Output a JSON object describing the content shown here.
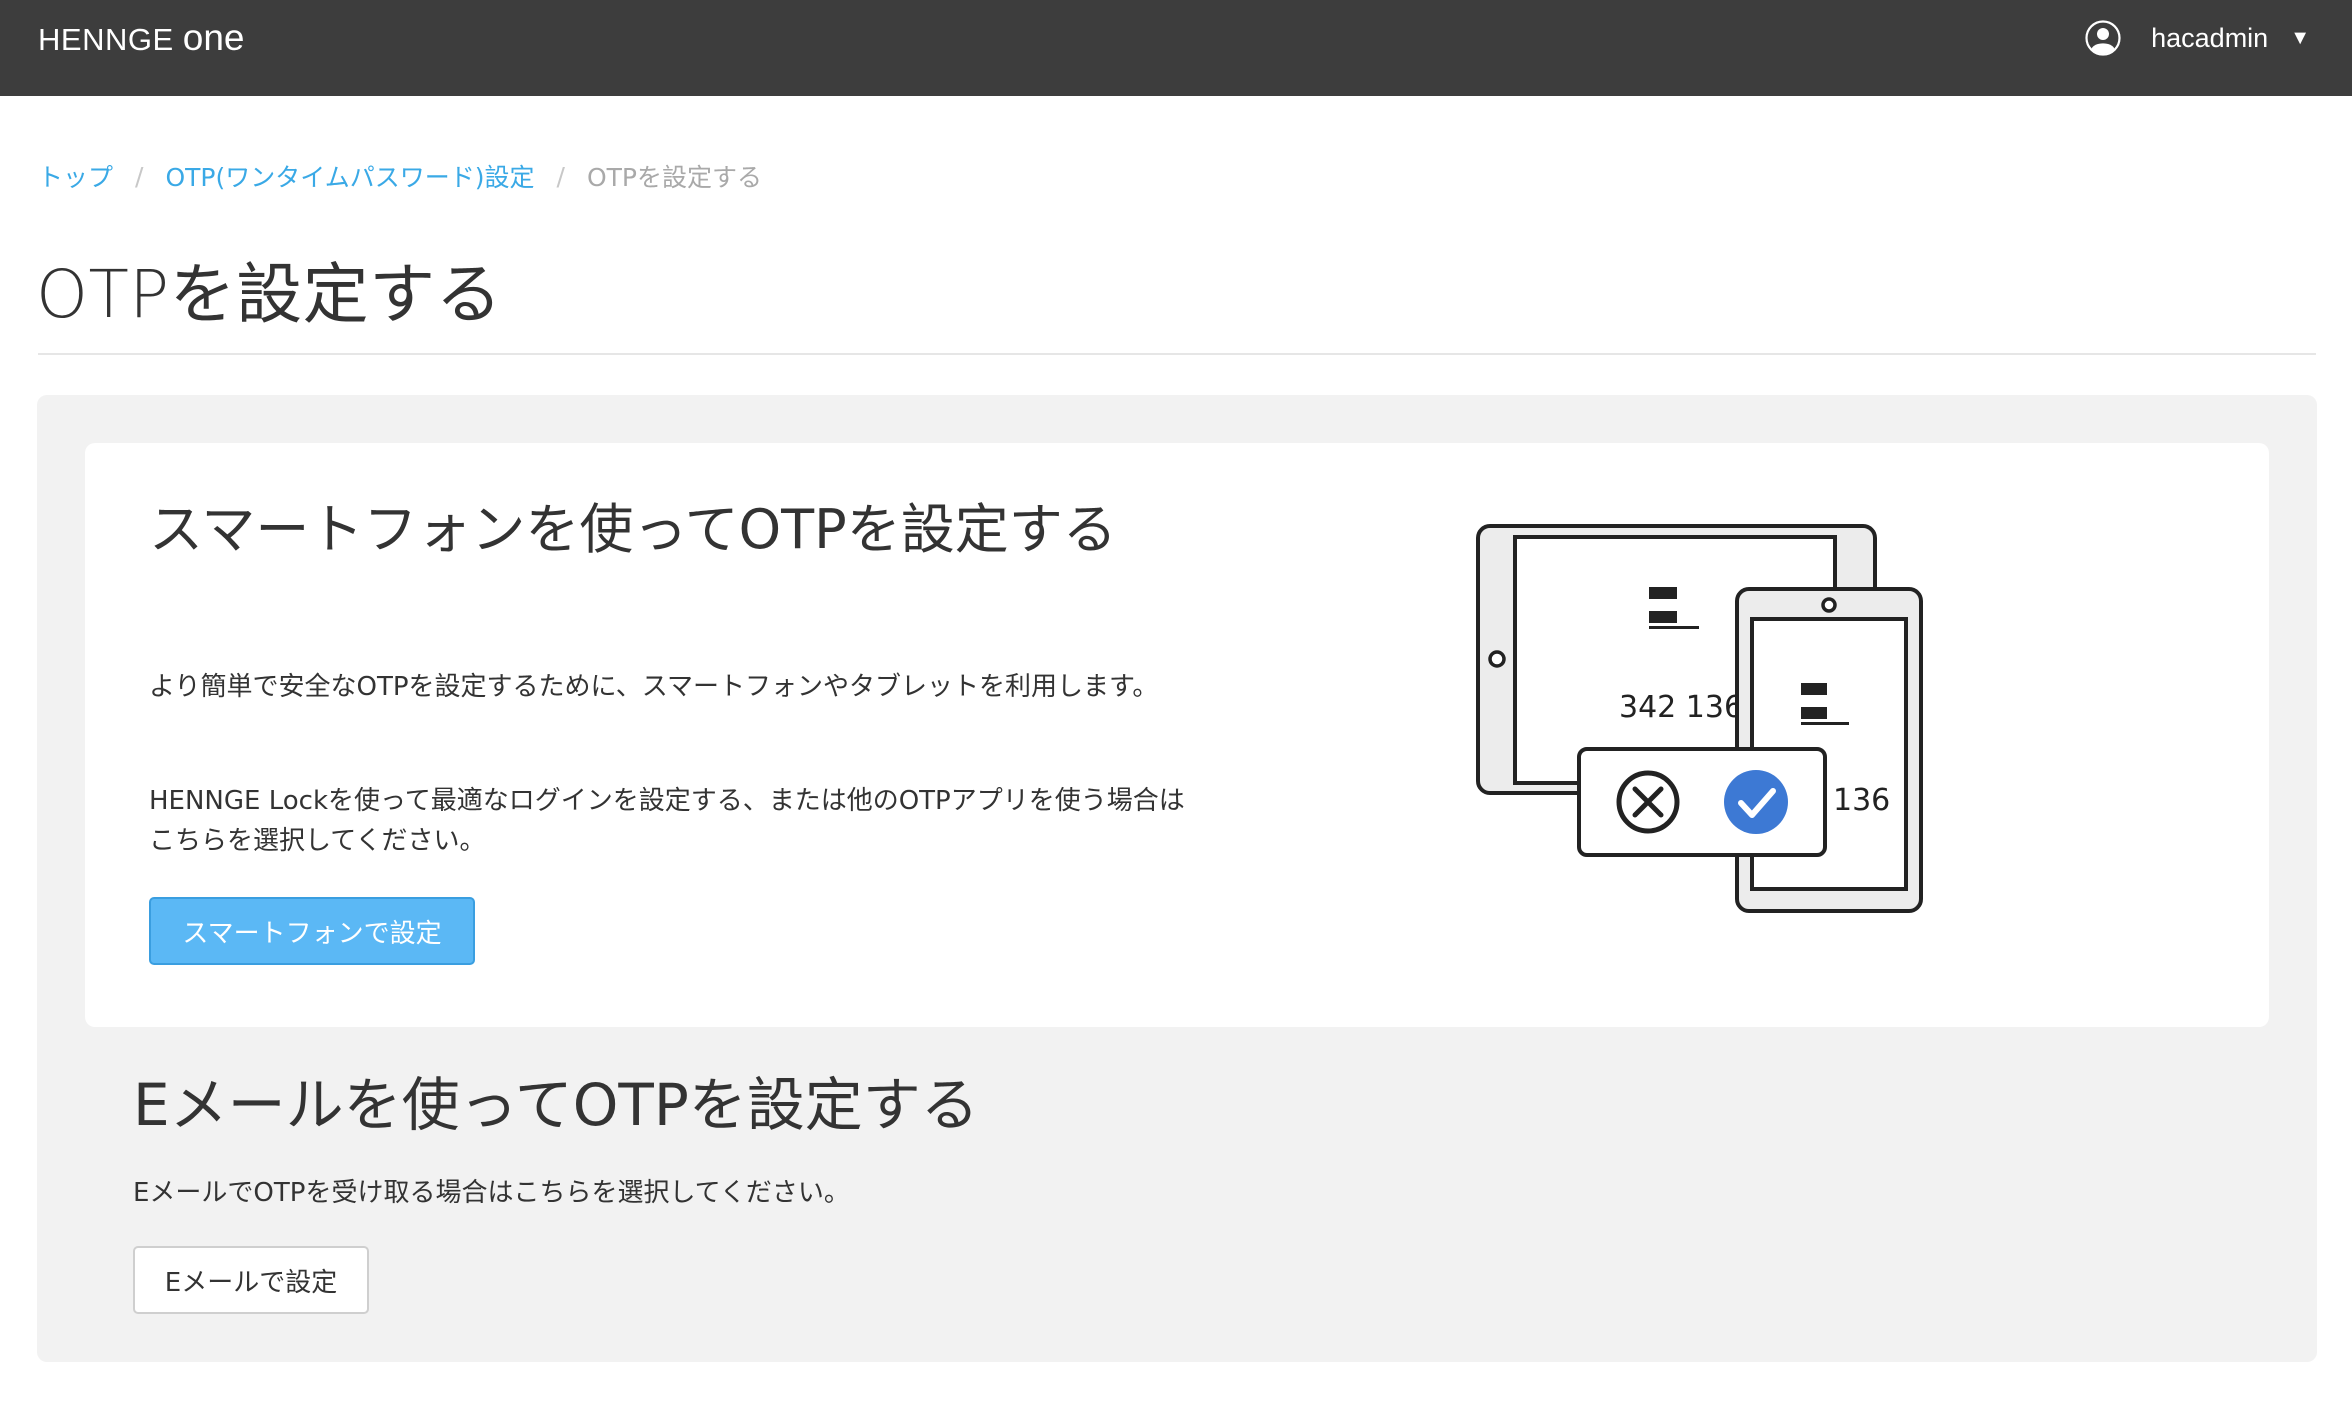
{
  "header": {
    "brand": "HENNGE",
    "brand_suffix": "one",
    "username": "hacadmin"
  },
  "breadcrumb": {
    "items": [
      "トップ",
      "OTP(ワンタイムパスワード)設定",
      "OTPを設定する"
    ],
    "separator": "/"
  },
  "page": {
    "title": "OTPを設定する"
  },
  "smartphone": {
    "title": "スマートフォンを使ってOTPを設定する",
    "text1": "より簡単で安全なOTPを設定するために、スマートフォンやタブレットを利用します。",
    "text2": "HENNGE Lockを使って最適なログインを設定する、または他のOTPアプリを使う場合はこちらを選択してください。",
    "button": "スマートフォンで設定",
    "illustration": {
      "tablet_code": "342 136",
      "phone_code": "136"
    }
  },
  "email": {
    "title": "Eメールを使ってOTPを設定する",
    "text": "EメールでOTPを受け取る場合はこちらを選択してください。",
    "button": "Eメールで設定"
  },
  "colors": {
    "topbar": "#3d3d3d",
    "link": "#3aa9e6",
    "primary": "#5bb8f5",
    "check": "#3d79d4"
  }
}
